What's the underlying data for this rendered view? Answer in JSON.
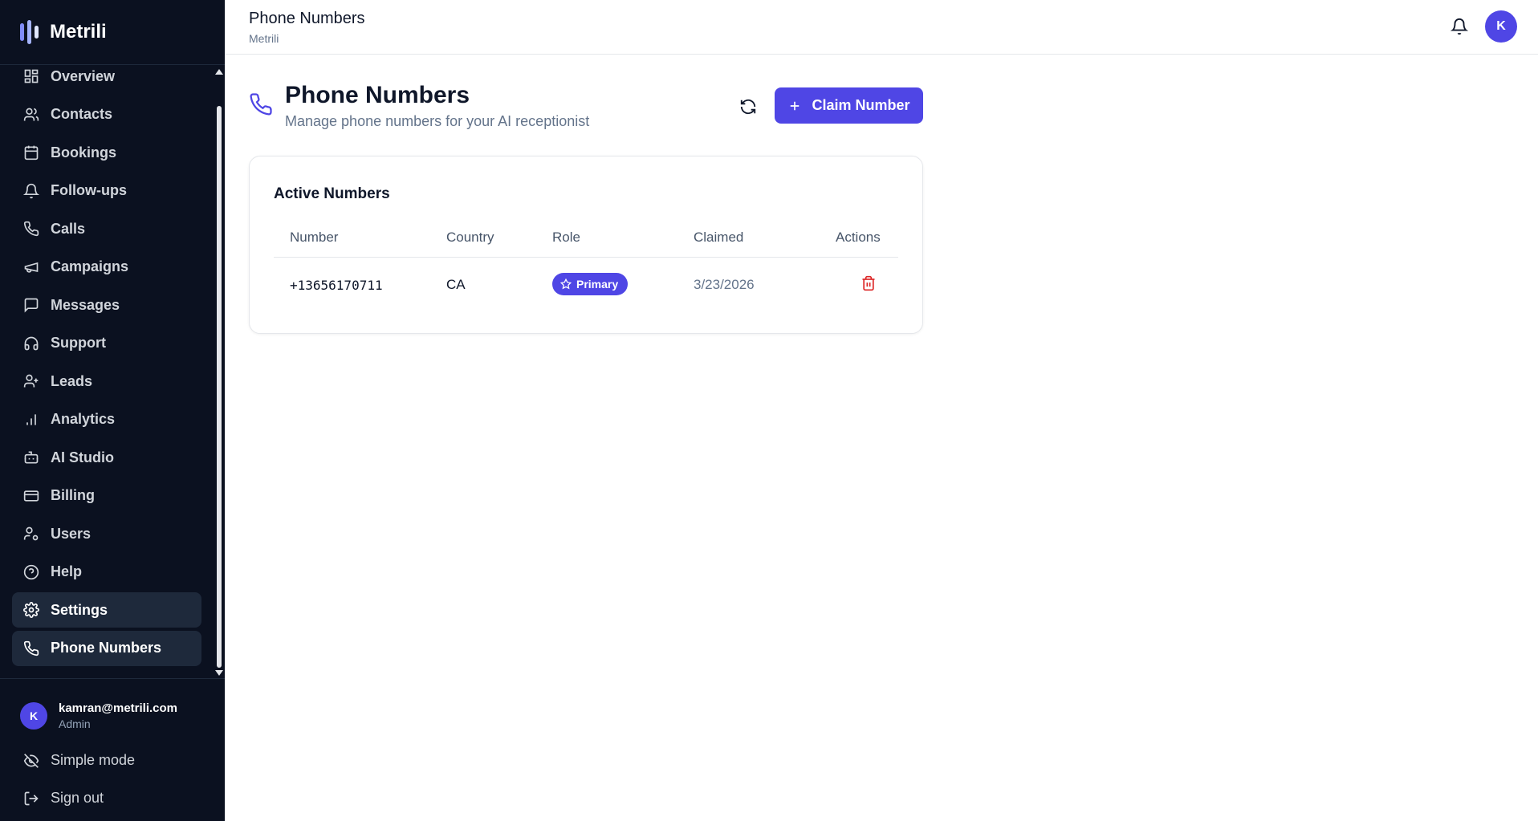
{
  "app": {
    "name": "Metrili"
  },
  "sidebar": {
    "items": [
      {
        "label": "Overview",
        "icon": "layout-grid-icon"
      },
      {
        "label": "Contacts",
        "icon": "users-icon"
      },
      {
        "label": "Bookings",
        "icon": "calendar-icon"
      },
      {
        "label": "Follow-ups",
        "icon": "bell-icon"
      },
      {
        "label": "Calls",
        "icon": "phone-icon"
      },
      {
        "label": "Campaigns",
        "icon": "megaphone-icon"
      },
      {
        "label": "Messages",
        "icon": "message-square-icon"
      },
      {
        "label": "Support",
        "icon": "headphones-icon"
      },
      {
        "label": "Leads",
        "icon": "user-plus-icon"
      },
      {
        "label": "Analytics",
        "icon": "bar-chart-icon"
      },
      {
        "label": "AI Studio",
        "icon": "bot-icon"
      },
      {
        "label": "Billing",
        "icon": "credit-card-icon"
      },
      {
        "label": "Users",
        "icon": "user-cog-icon"
      },
      {
        "label": "Help",
        "icon": "help-circle-icon"
      },
      {
        "label": "Settings",
        "icon": "gear-icon"
      },
      {
        "label": "Phone Numbers",
        "icon": "phone-icon"
      }
    ],
    "user": {
      "email": "kamran@metrili.com",
      "role": "Admin",
      "initial": "K"
    },
    "simple_mode": "Simple mode",
    "sign_out": "Sign out"
  },
  "header": {
    "title": "Phone Numbers",
    "subtitle": "Metrili",
    "avatar_initial": "K"
  },
  "page": {
    "title": "Phone Numbers",
    "subtitle": "Manage phone numbers for your AI receptionist",
    "claim_button": "Claim Number"
  },
  "table": {
    "title": "Active Numbers",
    "columns": [
      "Number",
      "Country",
      "Role",
      "Claimed",
      "Actions"
    ],
    "rows": [
      {
        "number": "+13656170711",
        "country": "CA",
        "role": "Primary",
        "claimed": "3/23/2026"
      }
    ]
  },
  "colors": {
    "accent": "#4f46e5",
    "sidebar_bg": "#0b1120",
    "danger": "#dc2626"
  }
}
